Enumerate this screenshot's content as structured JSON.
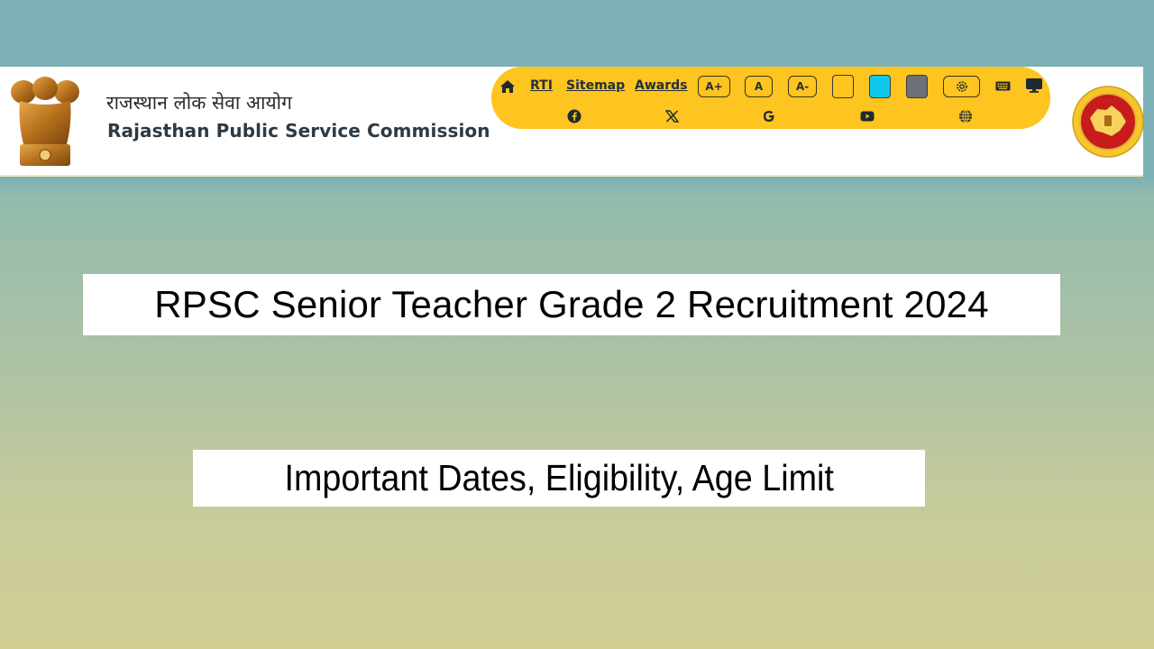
{
  "header": {
    "org_name_hindi": "राजस्थान लोक सेवा आयोग",
    "org_name_english": "Rajasthan Public Service Commission",
    "emblem_icon": "national-emblem-icon",
    "seal_icon": "rpsc-seal-icon"
  },
  "toolbar": {
    "home_icon": "home-icon",
    "links": [
      "RTI",
      "Sitemap",
      "Awards"
    ],
    "font_buttons": [
      "A+",
      "A",
      "A-"
    ],
    "theme_swatches": [
      {
        "name": "yellow-theme",
        "color": "#fec41f"
      },
      {
        "name": "cyan-theme",
        "color": "#10c8ec"
      },
      {
        "name": "grey-theme",
        "color": "#6b7177"
      }
    ],
    "settings_icon": "gear-icon",
    "keyboard_icon": "keyboard-icon",
    "screen_icon": "monitor-icon",
    "social_icons": [
      "facebook-icon",
      "x-icon",
      "google-icon",
      "youtube-icon",
      "globe-icon"
    ],
    "accent_color": "#fec41f"
  },
  "banner": {
    "title": "RPSC Senior Teacher Grade 2 Recruitment 2024",
    "subtitle": "Important Dates, Eligibility, Age Limit"
  }
}
